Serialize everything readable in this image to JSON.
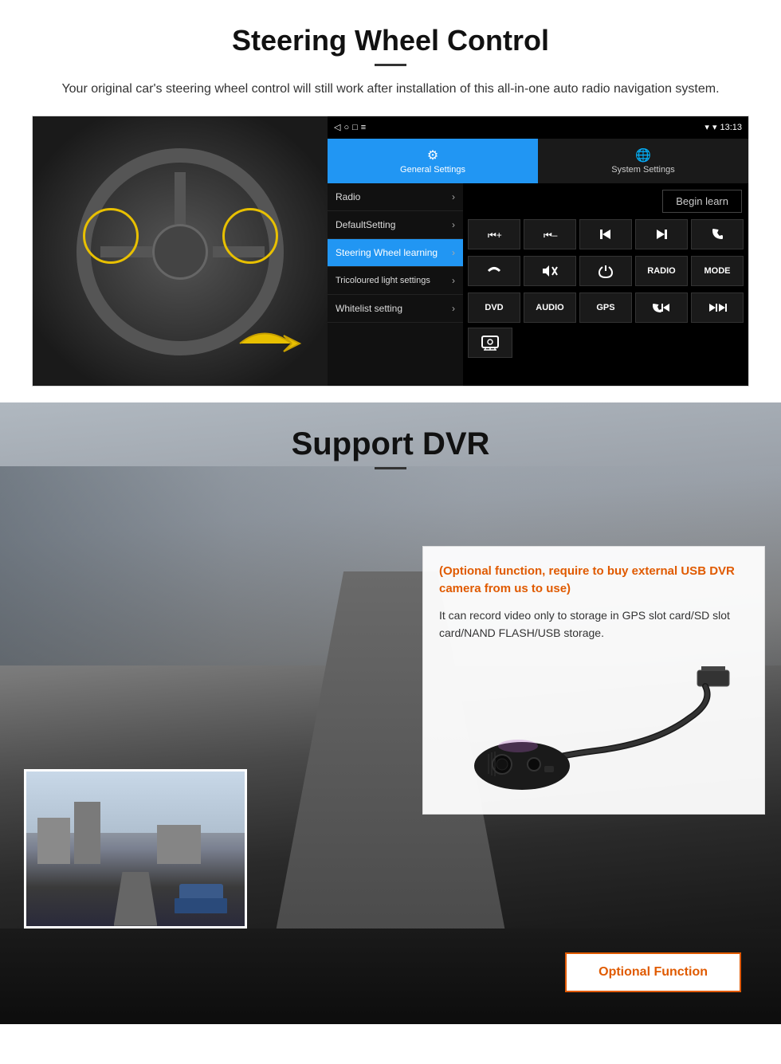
{
  "steering": {
    "title": "Steering Wheel Control",
    "subtitle": "Your original car's steering wheel control will still work after installation of this all-in-one auto radio navigation system.",
    "tabs": {
      "general_settings": "General Settings",
      "system_settings": "System Settings"
    },
    "menu_items": [
      {
        "label": "Radio",
        "active": false
      },
      {
        "label": "DefaultSetting",
        "active": false
      },
      {
        "label": "Steering Wheel learning",
        "active": true
      },
      {
        "label": "Tricoloured light settings",
        "active": false
      },
      {
        "label": "Whitelist setting",
        "active": false
      }
    ],
    "begin_learn_label": "Begin learn",
    "status_time": "13:13",
    "control_buttons": {
      "row1": [
        "⏮+",
        "⏮–",
        "⏮|",
        "|⏭",
        "📞"
      ],
      "row2": [
        "↩",
        "🔇x",
        "⏻",
        "RADIO",
        "MODE"
      ],
      "row3": [
        "DVD",
        "AUDIO",
        "GPS",
        "📞⏮|",
        "↩⏭"
      ]
    }
  },
  "dvr": {
    "title": "Support DVR",
    "optional_text": "(Optional function, require to buy external USB DVR camera from us to use)",
    "description": "It can record video only to storage in GPS slot card/SD slot card/NAND FLASH/USB storage.",
    "optional_button_label": "Optional Function"
  }
}
